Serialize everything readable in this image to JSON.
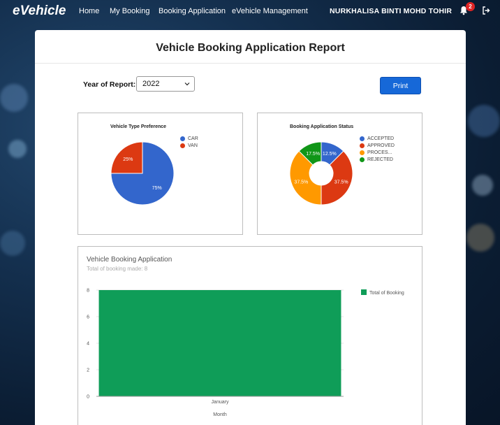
{
  "nav": {
    "brand": "eVehicle",
    "links": [
      "Home",
      "My Booking",
      "Booking Application",
      "eVehicle Management"
    ],
    "user": "NURKHALISA BINTI MOHD TOHIR",
    "notification_count": "2"
  },
  "report": {
    "title": "Vehicle Booking Application Report",
    "year_label": "Year of Report:",
    "year_value": "2022",
    "print_label": "Print"
  },
  "chart_data": [
    {
      "type": "pie",
      "title": "Vehicle Type Preference",
      "categories": [
        "CAR",
        "VAN"
      ],
      "values": [
        75,
        25
      ],
      "labels": [
        "75%",
        "25%"
      ],
      "colors": [
        "#3366cc",
        "#dc3912"
      ],
      "legend": "right"
    },
    {
      "type": "pie",
      "title": "Booking Application Status",
      "categories": [
        "ACCEPTED",
        "APPROVED",
        "PROCES...",
        "REJECTED"
      ],
      "values": [
        12.5,
        37.5,
        37.5,
        12.5
      ],
      "labels": [
        "12.5%",
        "37.5%",
        "37.5%",
        "17.5%"
      ],
      "colors": [
        "#3366cc",
        "#dc3912",
        "#ff9900",
        "#109618"
      ],
      "donut": true,
      "legend": "right"
    },
    {
      "type": "bar",
      "title": "Vehicle Booking Application",
      "subtitle": "Total of booking made: 8",
      "categories": [
        "January"
      ],
      "series": [
        {
          "name": "Total of Booking",
          "values": [
            8
          ]
        }
      ],
      "xlabel": "Month",
      "ylabel": "",
      "ylim": [
        0,
        8
      ],
      "yticks": [
        "0",
        "2",
        "4",
        "6",
        "8"
      ],
      "color": "#0f9d58",
      "grid": true,
      "legend": "right"
    }
  ]
}
